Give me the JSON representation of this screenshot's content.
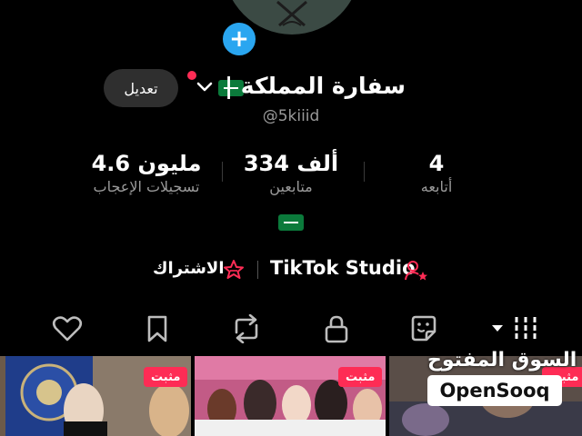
{
  "profile": {
    "display_name": "سفارة المملكة |",
    "username": "@5kiiid",
    "edit_label": "تعديل",
    "add_symbol": "+",
    "flag_name": "saudi-flag"
  },
  "stats": {
    "following": {
      "value": "4",
      "label": "أتابعه"
    },
    "followers": {
      "value": "334 ألف",
      "label": "متابعين"
    },
    "likes": {
      "value": "4.6 مليون",
      "label": "تسجيلات الإعجاب"
    }
  },
  "links": {
    "studio_label": "TikTok Studio",
    "subscription_label": "الاشتراك"
  },
  "tabs": [
    "videos-grid",
    "private",
    "reposts",
    "favorites",
    "liked"
  ],
  "videos": [
    {
      "pinned_label": "مثبت"
    },
    {
      "pinned_label": "مثبت"
    },
    {
      "pinned_label": "مثبت"
    }
  ],
  "watermark": {
    "arabic": "السوق المفتوح",
    "latin": "OpenSooq"
  },
  "colors": {
    "accent_pink": "#fe2c55",
    "add_blue": "#2aa6f0",
    "flag_green": "#0b7a3b",
    "muted_text": "#9a9a9a"
  }
}
